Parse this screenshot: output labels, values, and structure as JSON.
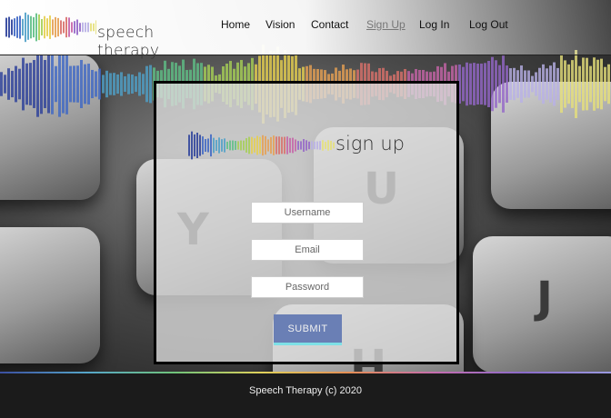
{
  "header": {
    "logo_text": "speech therapy",
    "nav": [
      {
        "label": "Home"
      },
      {
        "label": "Vision"
      },
      {
        "label": "Contact"
      },
      {
        "label": "Sign Up",
        "active": true
      },
      {
        "label": "Log In"
      },
      {
        "label": "Log Out"
      }
    ]
  },
  "backdrop_keys": [
    "Y",
    "U",
    "J",
    "H"
  ],
  "panel": {
    "title": "sign up",
    "fields": [
      {
        "placeholder": "Username"
      },
      {
        "placeholder": "Email"
      },
      {
        "placeholder": "Password"
      }
    ],
    "submit_label": "SUBMIT"
  },
  "footer": {
    "text": "Speech Therapy (c) 2020"
  },
  "colors": {
    "accent_button": "#6a7fb5",
    "button_underline": "#7ee0e6",
    "footer_bg": "#1b1b1b"
  }
}
